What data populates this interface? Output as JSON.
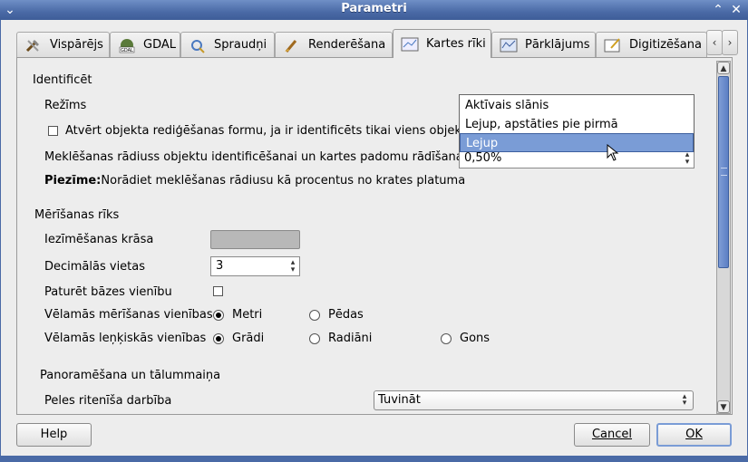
{
  "window": {
    "title": "Parametri"
  },
  "tabs": [
    {
      "label": "Vispārējs",
      "icon": "tools-icon"
    },
    {
      "label": "GDAL",
      "icon": "gdal-icon"
    },
    {
      "label": "Spraudņi",
      "icon": "plugin-icon"
    },
    {
      "label": "Renderēšana",
      "icon": "brush-icon"
    },
    {
      "label": "Kartes rīki",
      "icon": "map-tools-icon"
    },
    {
      "label": "Pārklājums",
      "icon": "overlay-icon"
    },
    {
      "label": "Digitizēšana",
      "icon": "digitize-icon"
    }
  ],
  "identify": {
    "section_title": "Identificēt",
    "mode_label": "Režīms",
    "checkbox_label": "Atvērt objekta rediģēšanas formu, ja ir identificēts tikai viens objekts",
    "radius_label": "Meklēšanas rādiuss objektu identificēšanai un kartes padomu rādīšanai",
    "radius_value": "0,50%",
    "note_bold": "Piezīme:",
    "note_text": "Norādiet meklēšanas rādiusu kā procentus no krates platuma",
    "mode_options": [
      "Aktīvais slānis",
      "Lejup, apstāties pie pirmā",
      "Lejup"
    ],
    "mode_selected": "Lejup"
  },
  "measure": {
    "section_title": "Mērīšanas rīks",
    "color_label": "Iezīmēšanas krāsa",
    "color_value": "#b8b8b8",
    "decimals_label": "Decimālās vietas",
    "decimals_value": "3",
    "keep_base_label": "Paturēt bāzes vienību",
    "units_label": "Vēlamās mērīšanas vienības",
    "units_metri": "Metri",
    "units_pedas": "Pēdas",
    "angle_label": "Vēlamās leņķiskās vienības",
    "angle_gradi": "Grādi",
    "angle_radiani": "Radiāni",
    "angle_gons": "Gons"
  },
  "pan": {
    "section_title": "Panoramēšana un tālummaiņa",
    "wheel_label": "Peles ritenīša darbība",
    "wheel_value": "Tuvināt"
  },
  "buttons": {
    "help": "Help",
    "cancel": "Cancel",
    "ok": "OK"
  }
}
